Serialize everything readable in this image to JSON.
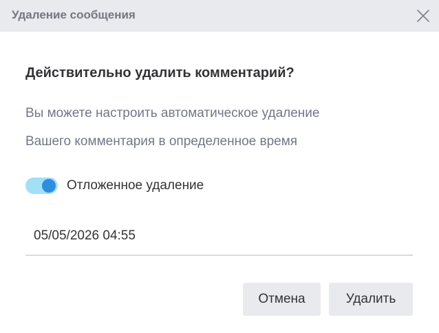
{
  "dialog": {
    "title": "Удаление сообщения",
    "close_icon": "close-icon",
    "question": "Действительно удалить комментарий?",
    "description_line1": "Вы можете настроить автоматическое удаление",
    "description_line2": "Вашего комментария в определенное время",
    "delayed_toggle": {
      "label": "Отложенное удаление",
      "checked": true
    },
    "datetime_value": "05/05/2026 04:55",
    "cancel_label": "Отмена",
    "delete_label": "Удалить"
  },
  "colors": {
    "header_bg": "#e9eaee",
    "toggle_track": "#a3e0f7",
    "toggle_knob": "#2d8ee0",
    "text_primary": "#333336",
    "text_secondary": "#727786"
  }
}
